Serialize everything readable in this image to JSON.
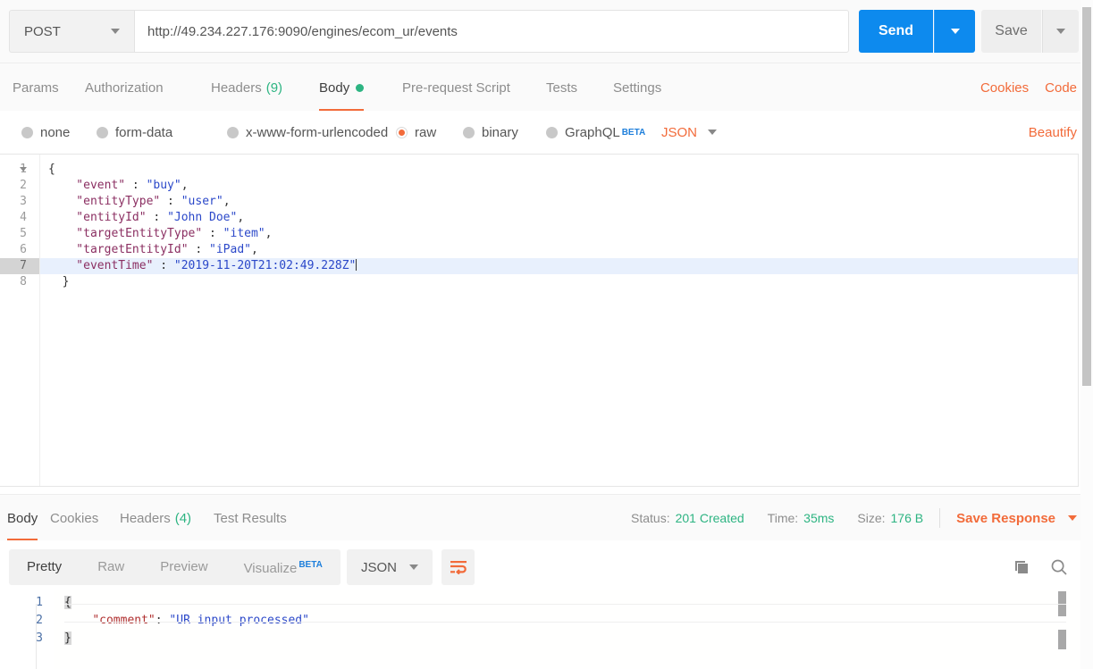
{
  "request": {
    "method": "POST",
    "url": "http://49.234.227.176:9090/engines/ecom_ur/events",
    "url_placeholder": "Enter request URL",
    "send_label": "Send",
    "save_label": "Save",
    "tabs": [
      {
        "label": "Params",
        "count": "",
        "active": false,
        "dot": false
      },
      {
        "label": "Authorization",
        "count": "",
        "active": false,
        "dot": false
      },
      {
        "label": "Headers",
        "count": "(9)",
        "active": false,
        "dot": false
      },
      {
        "label": "Body",
        "count": "",
        "active": true,
        "dot": true
      },
      {
        "label": "Pre-request Script",
        "count": "",
        "active": false,
        "dot": false
      },
      {
        "label": "Tests",
        "count": "",
        "active": false,
        "dot": false
      },
      {
        "label": "Settings",
        "count": "",
        "active": false,
        "dot": false
      }
    ],
    "right_links": [
      "Cookies",
      "Code"
    ],
    "body_types": [
      {
        "label": "none",
        "selected": false
      },
      {
        "label": "form-data",
        "selected": false
      },
      {
        "label": "x-www-form-urlencoded",
        "selected": false
      },
      {
        "label": "raw",
        "selected": true
      },
      {
        "label": "binary",
        "selected": false
      },
      {
        "label": "GraphQL",
        "selected": false,
        "badge": "BETA"
      }
    ],
    "raw_format": "JSON",
    "beautify_label": "Beautify",
    "editor": {
      "active_line": 7,
      "lines": [
        {
          "n": "1",
          "fold": true,
          "segments": [
            {
              "t": "{",
              "c": "p"
            }
          ]
        },
        {
          "n": "2",
          "fold": false,
          "segments": [
            {
              "t": "    \"event\"",
              "c": "k"
            },
            {
              "t": " : ",
              "c": "p"
            },
            {
              "t": "\"buy\"",
              "c": "v"
            },
            {
              "t": ",",
              "c": "p"
            }
          ]
        },
        {
          "n": "3",
          "fold": false,
          "segments": [
            {
              "t": "    \"entityType\"",
              "c": "k"
            },
            {
              "t": " : ",
              "c": "p"
            },
            {
              "t": "\"user\"",
              "c": "v"
            },
            {
              "t": ",",
              "c": "p"
            }
          ]
        },
        {
          "n": "4",
          "fold": false,
          "segments": [
            {
              "t": "    \"entityId\"",
              "c": "k"
            },
            {
              "t": " : ",
              "c": "p"
            },
            {
              "t": "\"John Doe\"",
              "c": "v"
            },
            {
              "t": ",",
              "c": "p"
            }
          ]
        },
        {
          "n": "5",
          "fold": false,
          "segments": [
            {
              "t": "    \"targetEntityType\"",
              "c": "k"
            },
            {
              "t": " : ",
              "c": "p"
            },
            {
              "t": "\"item\"",
              "c": "v"
            },
            {
              "t": ",",
              "c": "p"
            }
          ]
        },
        {
          "n": "6",
          "fold": false,
          "segments": [
            {
              "t": "    \"targetEntityId\"",
              "c": "k"
            },
            {
              "t": " : ",
              "c": "p"
            },
            {
              "t": "\"iPad\"",
              "c": "v"
            },
            {
              "t": ",",
              "c": "p"
            }
          ]
        },
        {
          "n": "7",
          "fold": false,
          "segments": [
            {
              "t": "    \"eventTime\"",
              "c": "k"
            },
            {
              "t": " : ",
              "c": "p"
            },
            {
              "t": "\"2019-11-20T21:02:49.228Z\"",
              "c": "v"
            }
          ]
        },
        {
          "n": "8",
          "fold": false,
          "segments": [
            {
              "t": "  }",
              "c": "p"
            }
          ]
        }
      ]
    }
  },
  "response": {
    "tabs": [
      {
        "label": "Body",
        "count": "",
        "active": true
      },
      {
        "label": "Cookies",
        "count": "",
        "active": false
      },
      {
        "label": "Headers",
        "count": "(4)",
        "active": false
      },
      {
        "label": "Test Results",
        "count": "",
        "active": false
      }
    ],
    "status_label": "Status:",
    "status_value": "201 Created",
    "time_label": "Time:",
    "time_value": "35ms",
    "size_label": "Size:",
    "size_value": "176 B",
    "save_response_label": "Save Response",
    "format_tabs": [
      {
        "label": "Pretty",
        "active": true,
        "badge": ""
      },
      {
        "label": "Raw",
        "active": false,
        "badge": ""
      },
      {
        "label": "Preview",
        "active": false,
        "badge": ""
      },
      {
        "label": "Visualize",
        "active": false,
        "badge": "BETA"
      }
    ],
    "format_type": "JSON",
    "body": {
      "lines": [
        {
          "n": "1",
          "segments": [
            {
              "t": "{",
              "c": "brace"
            }
          ]
        },
        {
          "n": "2",
          "segments": [
            {
              "t": "    ",
              "c": "p"
            },
            {
              "t": "\"comment\"",
              "c": "rk"
            },
            {
              "t": ": ",
              "c": "p"
            },
            {
              "t": "\"UR input processed\"",
              "c": "rv"
            }
          ]
        },
        {
          "n": "3",
          "segments": [
            {
              "t": "}",
              "c": "brace"
            }
          ]
        }
      ]
    }
  },
  "colors": {
    "accent_orange": "#f26b3a",
    "send_blue": "#0d8aee",
    "status_green": "#2db482",
    "beta_blue": "#1e7fdb",
    "json_key": "#8b2f62",
    "json_value": "#2b48c9",
    "resp_key": "#b03030"
  }
}
